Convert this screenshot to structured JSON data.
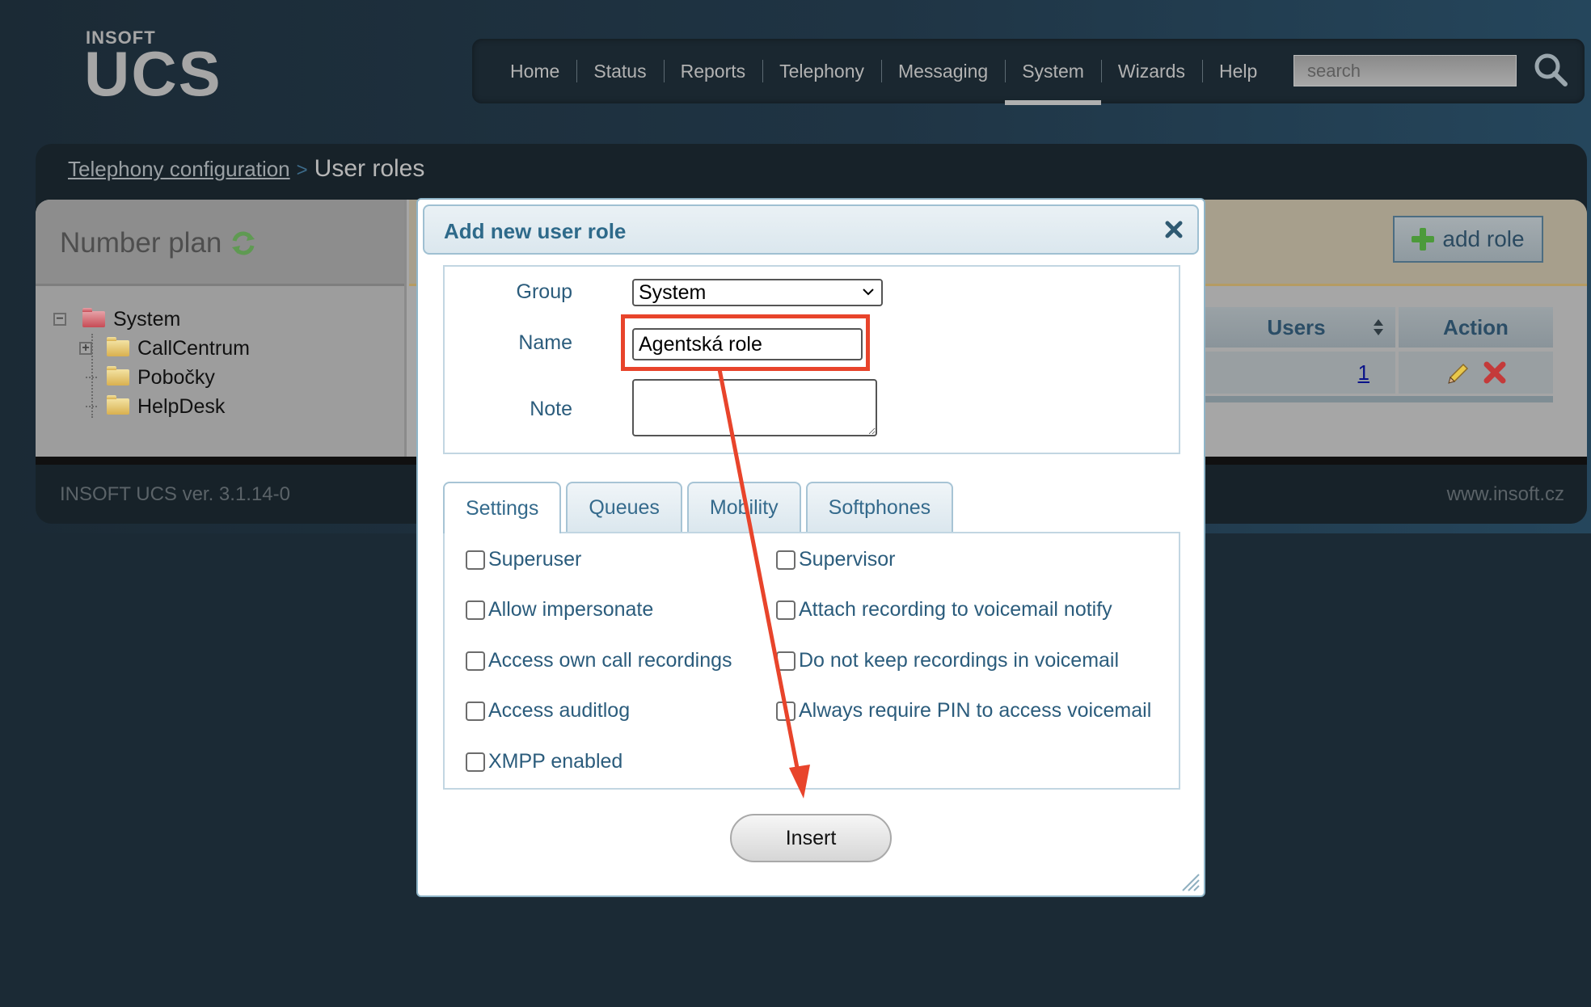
{
  "logo": {
    "brand_small": "INSOFT",
    "brand_big": "UCS"
  },
  "nav": {
    "items": [
      {
        "label": "Home"
      },
      {
        "label": "Status"
      },
      {
        "label": "Reports"
      },
      {
        "label": "Telephony"
      },
      {
        "label": "Messaging"
      },
      {
        "label": "System",
        "active": true
      },
      {
        "label": "Wizards"
      },
      {
        "label": "Help"
      }
    ],
    "search_placeholder": "search",
    "search_icon": "magnifier-icon"
  },
  "breadcrumb": {
    "parent": "Telephony configuration",
    "separator": ">",
    "current": "User roles"
  },
  "number_plan": {
    "title": "Number plan",
    "refresh_icon": "refresh-icon",
    "tree": {
      "root": {
        "label": "System",
        "expanded": true,
        "icon": "folder-red"
      },
      "children": [
        {
          "label": "CallCentrum",
          "expandable": true
        },
        {
          "label": "Pobočky"
        },
        {
          "label": "HelpDesk"
        }
      ]
    }
  },
  "roles_panel": {
    "add_button": "add role",
    "columns": [
      "Users",
      "Action"
    ],
    "rows": [
      {
        "users": "1",
        "actions": [
          "edit",
          "delete"
        ]
      }
    ]
  },
  "footer": {
    "version": "INSOFT UCS ver. 3.1.14-0",
    "website": "www.insoft.cz"
  },
  "modal": {
    "title": "Add new user role",
    "close_icon": "close-icon",
    "fields": {
      "group_label": "Group",
      "group_value": "System",
      "name_label": "Name",
      "name_value": "Agentská role",
      "note_label": "Note",
      "note_value": ""
    },
    "tabs": [
      {
        "label": "Settings",
        "active": true
      },
      {
        "label": "Queues"
      },
      {
        "label": "Mobility"
      },
      {
        "label": "Softphones"
      }
    ],
    "settings_left": [
      {
        "label": "Superuser",
        "checked": false
      },
      {
        "label": "Allow impersonate",
        "checked": false
      },
      {
        "label": "Access own call recordings",
        "checked": false
      },
      {
        "label": "Access auditlog",
        "checked": false
      },
      {
        "label": "XMPP enabled",
        "checked": false
      }
    ],
    "settings_right": [
      {
        "label": "Supervisor",
        "checked": false
      },
      {
        "label": "Attach recording to voicemail notify",
        "checked": false
      },
      {
        "label": "Do not keep recordings in voicemail",
        "checked": false
      },
      {
        "label": "Always require PIN to access voicemail",
        "checked": false
      }
    ],
    "submit_label": "Insert"
  },
  "annotation": {
    "color": "#e8442b",
    "highlight_target": "name-input",
    "arrow_target": "insert-button"
  }
}
